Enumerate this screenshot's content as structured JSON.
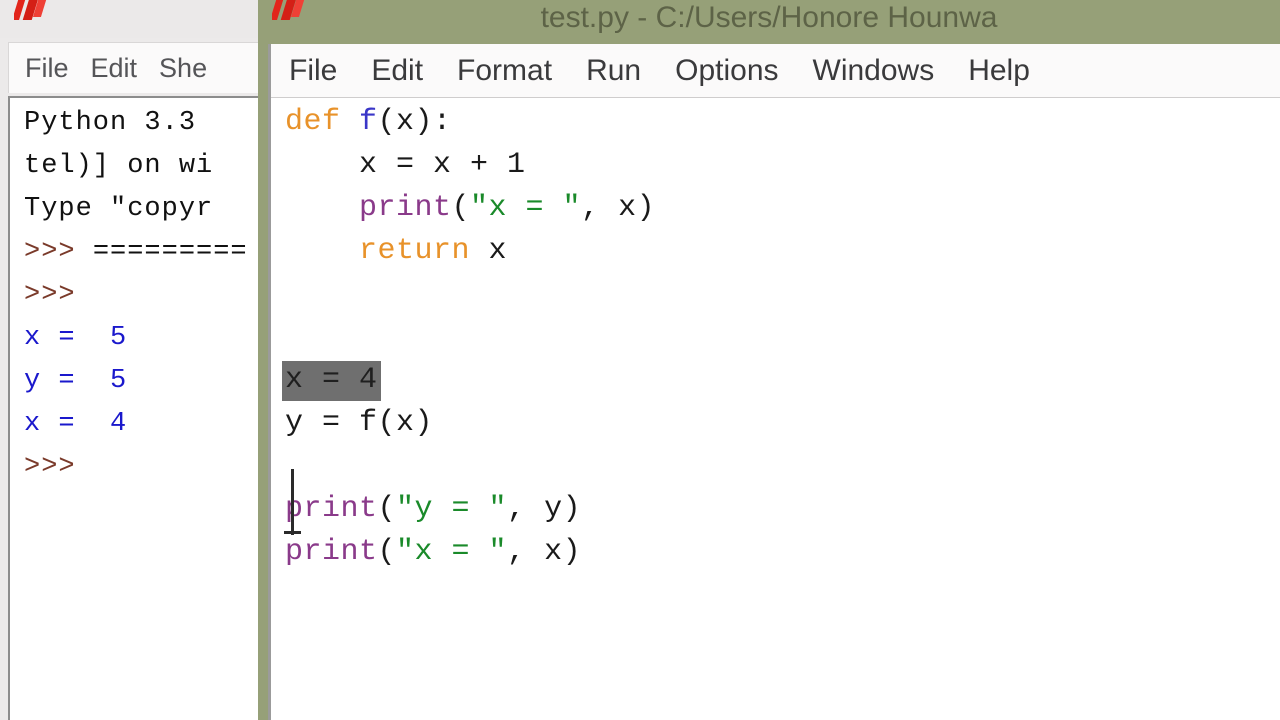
{
  "colors": {
    "window_frame": "#96a078",
    "titlebar_text": "#5d6347",
    "editor_background": "#ffffff",
    "shell_background": "#ffffff",
    "prompt": "#7a3a2a",
    "stdout": "#1a18cc",
    "keyword": "#e8922a",
    "definition": "#3a36c8",
    "builtin": "#8a3a8a",
    "string": "#1a8a2a",
    "selection": "#6f6f6f"
  },
  "shell_window": {
    "icon": "python-idle-icon",
    "title": "",
    "menu": [
      {
        "label": "File"
      },
      {
        "label": "Edit"
      },
      {
        "label": "She"
      }
    ],
    "lines": [
      {
        "segments": [
          {
            "text": "Python 3.3",
            "cls": "c-plain"
          }
        ]
      },
      {
        "segments": [
          {
            "text": "tel)] on wi",
            "cls": "c-plain"
          }
        ]
      },
      {
        "segments": [
          {
            "text": "Type \"copyr",
            "cls": "c-plain"
          }
        ]
      },
      {
        "segments": [
          {
            "text": ">>> ",
            "cls": "c-prompt"
          },
          {
            "text": "=========",
            "cls": "c-plain"
          }
        ]
      },
      {
        "segments": [
          {
            "text": ">>>",
            "cls": "c-prompt"
          }
        ]
      },
      {
        "segments": [
          {
            "text": "x =  5",
            "cls": "c-stdout"
          }
        ]
      },
      {
        "segments": [
          {
            "text": "y =  5",
            "cls": "c-stdout"
          }
        ]
      },
      {
        "segments": [
          {
            "text": "x =  4",
            "cls": "c-stdout"
          }
        ]
      },
      {
        "segments": [
          {
            "text": ">>>",
            "cls": "c-prompt"
          }
        ]
      }
    ]
  },
  "editor_window": {
    "icon": "python-idle-icon",
    "title": "test.py - C:/Users/Honore Hounwa",
    "menu": [
      {
        "label": "File"
      },
      {
        "label": "Edit"
      },
      {
        "label": "Format"
      },
      {
        "label": "Run"
      },
      {
        "label": "Options"
      },
      {
        "label": "Windows"
      },
      {
        "label": "Help"
      }
    ],
    "code_lines": [
      {
        "segments": [
          {
            "text": "def ",
            "cls": "k-def"
          },
          {
            "text": "f",
            "cls": "k-func"
          },
          {
            "text": "(x):",
            "cls": "k-norm"
          }
        ]
      },
      {
        "segments": [
          {
            "text": "    x = x + 1",
            "cls": "k-norm"
          }
        ]
      },
      {
        "segments": [
          {
            "text": "    ",
            "cls": "k-norm"
          },
          {
            "text": "print",
            "cls": "k-builtin"
          },
          {
            "text": "(",
            "cls": "k-norm"
          },
          {
            "text": "\"x = \"",
            "cls": "k-string"
          },
          {
            "text": ", x)",
            "cls": "k-norm"
          }
        ]
      },
      {
        "segments": [
          {
            "text": "    ",
            "cls": "k-norm"
          },
          {
            "text": "return ",
            "cls": "k-def"
          },
          {
            "text": "x",
            "cls": "k-norm"
          }
        ]
      },
      {
        "segments": [
          {
            "text": "",
            "cls": "k-norm"
          }
        ]
      },
      {
        "segments": [
          {
            "text": "",
            "cls": "k-norm"
          }
        ]
      },
      {
        "segments": [
          {
            "text": "x = 4",
            "cls": "k-norm",
            "selected": true
          }
        ]
      },
      {
        "segments": [
          {
            "text": "y = ",
            "cls": "k-norm"
          },
          {
            "text": "f",
            "cls": "k-norm"
          },
          {
            "text": "(x)",
            "cls": "k-norm"
          }
        ]
      },
      {
        "segments": [
          {
            "text": "",
            "cls": "k-norm"
          }
        ]
      },
      {
        "segments": [
          {
            "text": "print",
            "cls": "k-builtin"
          },
          {
            "text": "(",
            "cls": "k-norm"
          },
          {
            "text": "\"y = \"",
            "cls": "k-string"
          },
          {
            "text": ", y)",
            "cls": "k-norm"
          }
        ]
      },
      {
        "segments": [
          {
            "text": "print",
            "cls": "k-builtin"
          },
          {
            "text": "(",
            "cls": "k-norm"
          },
          {
            "text": "\"x = \"",
            "cls": "k-string"
          },
          {
            "text": ", x)",
            "cls": "k-norm"
          }
        ]
      }
    ],
    "selection": {
      "line_index": 6,
      "text": "x = 4"
    },
    "caret": {
      "line_index": 7,
      "column": 0
    }
  }
}
